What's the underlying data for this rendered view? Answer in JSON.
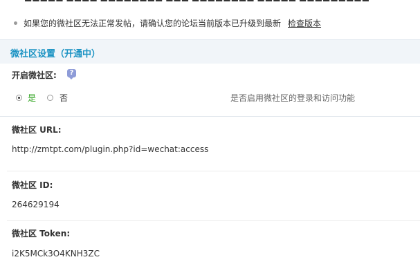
{
  "notice": {
    "message": "如果您的微社区无法正常发帖，请确认您的论坛当前版本已升级到最新",
    "link_label": "检查版本"
  },
  "section": {
    "title": "微社区设置（开通中）"
  },
  "enable": {
    "label": "开启微社区:",
    "option_yes": "是",
    "option_no": "否",
    "selected": "是",
    "hint": "是否启用微社区的登录和访问功能"
  },
  "url": {
    "label": "微社区 URL:",
    "value": "http://zmtpt.com/plugin.php?id=wechat:access"
  },
  "id": {
    "label": "微社区 ID:",
    "value": "264629194"
  },
  "token": {
    "label": "微社区 Token:",
    "value": "i2K5MCk3O4KNH3ZC"
  },
  "colors": {
    "section_title": "#1b93c3",
    "section_bg": "#f1f5f9",
    "radio_yes_label": "#2fa31f"
  }
}
